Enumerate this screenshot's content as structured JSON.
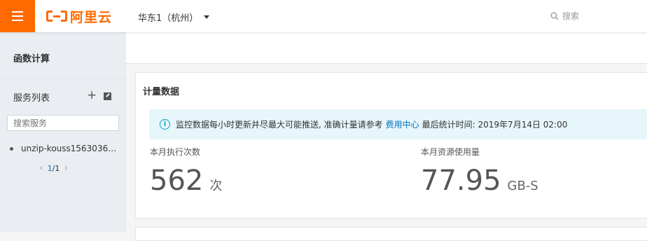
{
  "header": {
    "brand_text": "阿里云",
    "region_label": "华东1（杭州）",
    "search_label": "搜索",
    "accent_color": "#ff6a00",
    "menu_icon": "hamburger-icon"
  },
  "sidebar": {
    "title": "函数计算",
    "services_header": "服务列表",
    "add_icon": "plus-icon",
    "edit_icon": "edit-icon",
    "search_placeholder": "搜索服务",
    "services": [
      {
        "name": "unzip-kouss1563036…"
      }
    ],
    "pagination": {
      "current": "1",
      "total": "/1"
    }
  },
  "main": {
    "panel_title": "计量数据",
    "notice": {
      "text_before": "监控数据每小时更新并尽最大可能推送, 准确计量请参考",
      "link_text": "费用中心",
      "text_after": "最后统计时间: 2019年7月14日 02:00"
    },
    "metrics": [
      {
        "label": "本月执行次数",
        "value": "562",
        "unit": "次"
      },
      {
        "label": "本月资源使用量",
        "value": "77.95",
        "unit": "GB-S"
      }
    ]
  }
}
